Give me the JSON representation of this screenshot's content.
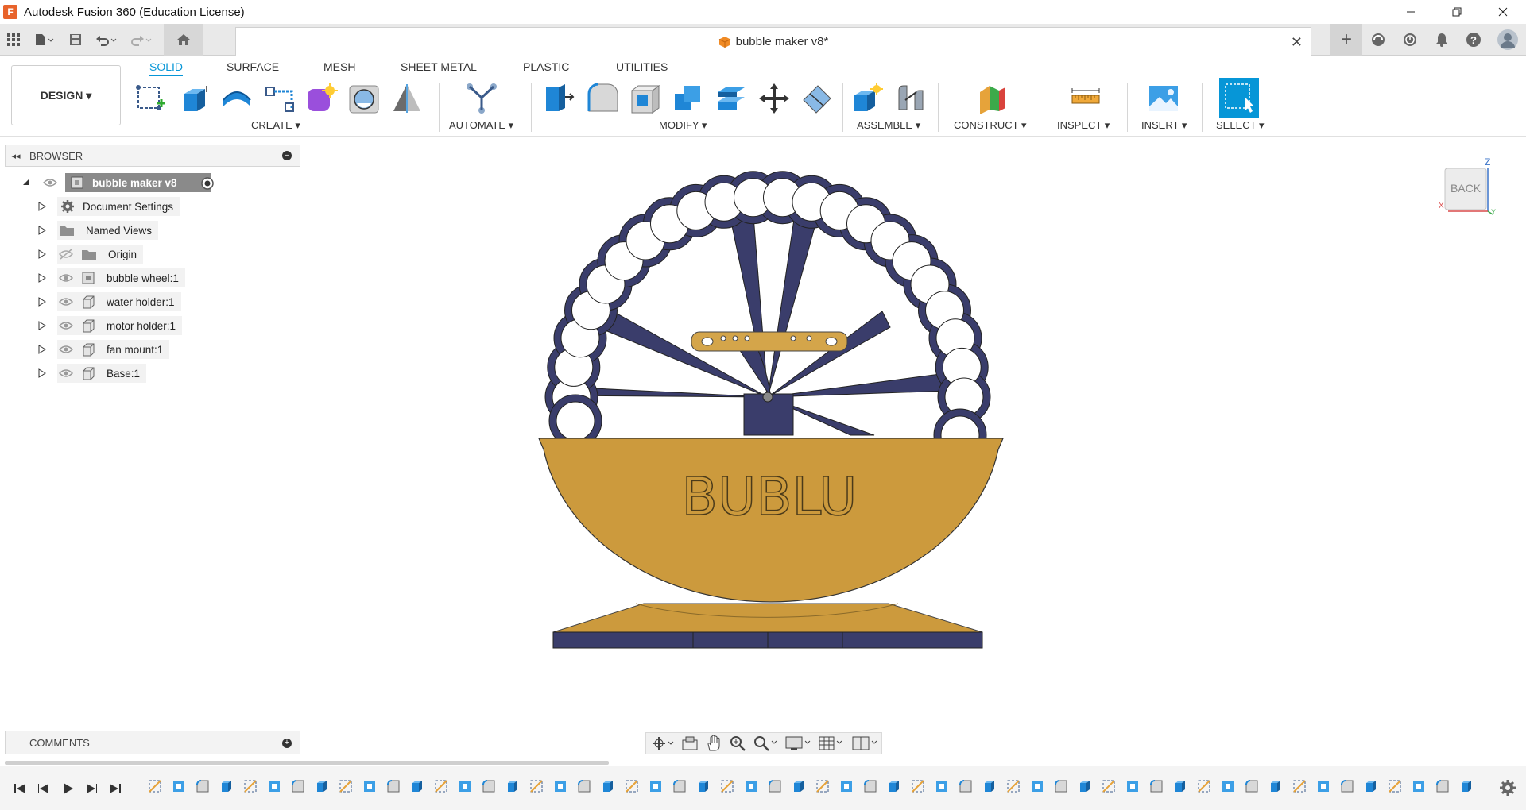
{
  "window": {
    "app_title": "Autodesk Fusion 360 (Education License)",
    "controls": [
      "minimize",
      "restore",
      "close"
    ]
  },
  "document_tab": {
    "title": "bubble maker v8*"
  },
  "workspace": {
    "design_label": "DESIGN ▾"
  },
  "ribbon": {
    "tabs": [
      {
        "label": "SOLID",
        "active": true
      },
      {
        "label": "SURFACE",
        "active": false
      },
      {
        "label": "MESH",
        "active": false
      },
      {
        "label": "SHEET METAL",
        "active": false
      },
      {
        "label": "PLASTIC",
        "active": false
      },
      {
        "label": "UTILITIES",
        "active": false
      }
    ],
    "groups": {
      "create": "CREATE ▾",
      "automate": "AUTOMATE ▾",
      "modify": "MODIFY ▾",
      "assemble": "ASSEMBLE ▾",
      "construct": "CONSTRUCT ▾",
      "inspect": "INSPECT ▾",
      "insert": "INSERT ▾",
      "select": "SELECT ▾"
    }
  },
  "browser": {
    "title": "BROWSER",
    "root": "bubble maker v8",
    "items": [
      {
        "label": "Document Settings",
        "icon": "gear-icon",
        "eye": false
      },
      {
        "label": "Named Views",
        "icon": "folder-icon",
        "eye": false
      },
      {
        "label": "Origin",
        "icon": "folder-icon",
        "eye": "hidden"
      },
      {
        "label": "bubble wheel:1",
        "icon": "component-icon",
        "eye": true
      },
      {
        "label": "water holder:1",
        "icon": "body-icon",
        "eye": true
      },
      {
        "label": "motor holder:1",
        "icon": "body-icon",
        "eye": true
      },
      {
        "label": "fan mount:1",
        "icon": "body-icon",
        "eye": true
      },
      {
        "label": "Base:1",
        "icon": "body-icon",
        "eye": true
      }
    ]
  },
  "comments": {
    "title": "COMMENTS"
  },
  "viewport": {
    "model_text": "BUBLU",
    "viewcube_face": "BACK",
    "axis_z": "Z",
    "axis_x": "X",
    "axis_y": "Y",
    "colors": {
      "wheel": "#3a3d6b",
      "bowl": "#cc9a3d",
      "base_bar": "#3a3d6b",
      "mount": "#d4a54a"
    }
  },
  "timeline": {
    "feature_count": 56
  }
}
